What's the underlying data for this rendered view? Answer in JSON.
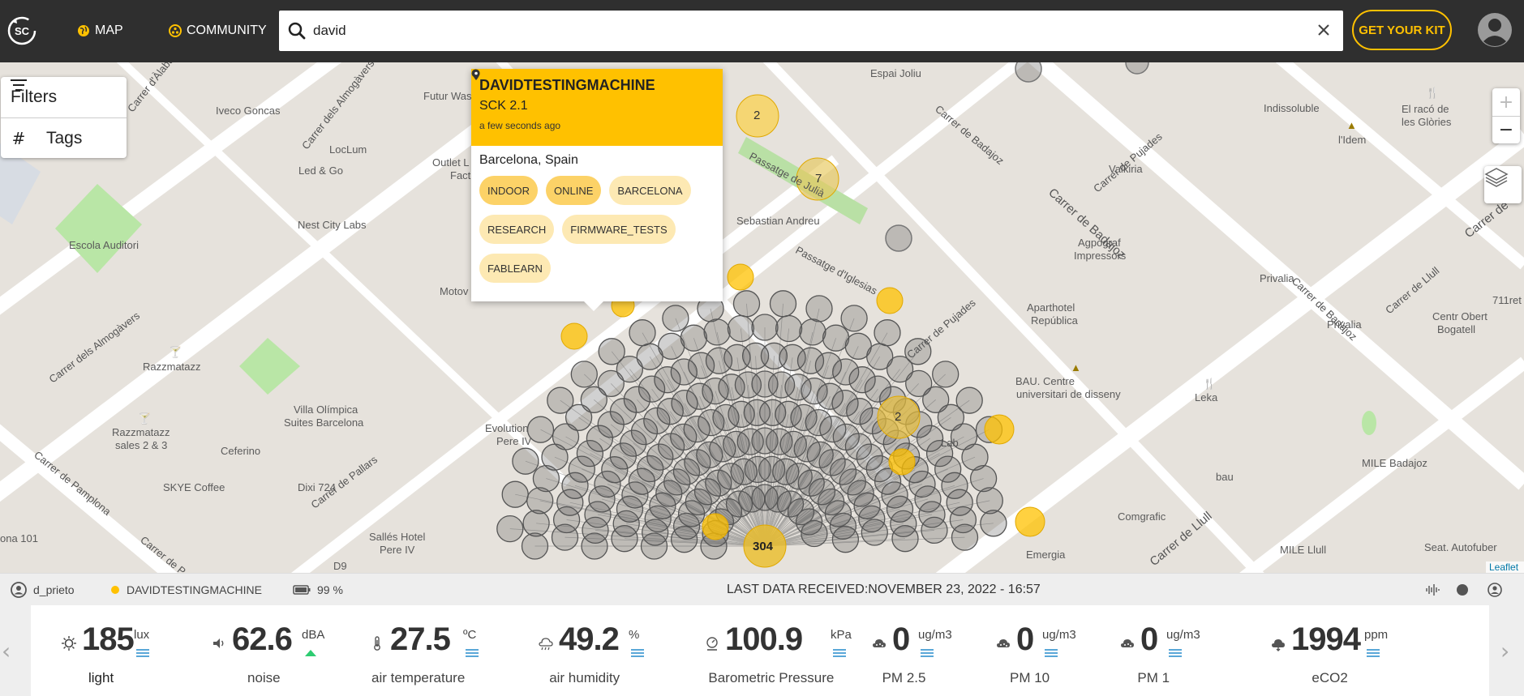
{
  "topbar": {
    "logo_text": "SC",
    "nav_map": "MAP",
    "nav_community": "COMMUNITY",
    "search_value": "david",
    "get_kit": "GET YOUR KIT",
    "accent_color": "#ffc100"
  },
  "map_panel": {
    "filters_label": "Filters",
    "tags_label": "Tags",
    "tags_icon": "#",
    "attribution": "Leaflet"
  },
  "map_labels": {
    "espai_joliu": "Espai Joliu",
    "iveco": "Iveco Goncas",
    "futur": "Futur Was",
    "outlet": "Outlet L",
    "fact": "Fact",
    "loclum": "LocLum",
    "ledgo": "Led & Go",
    "nestcity": "Nest City Labs",
    "escola": "Escola Auditori",
    "motov": "Motov",
    "razzmatazz": "Razzmatazz",
    "villa1": "Villa Olímpica",
    "villa2": "Suites Barcelona",
    "razz2a": "Razzmatazz",
    "razz2b": "sales 2 & 3",
    "ceferino": "Ceferino",
    "skye": "SKYE Coffee",
    "dixi": "Dixi 724",
    "salles1": "Sallés Hotel",
    "salles2": "Pere IV",
    "d9": "D9",
    "ona": "ona 101",
    "evolution1": "Evolution",
    "evolution2": "Pere IV",
    "sebastian": "Sebastian Andreu",
    "indissoluble": "Indissoluble",
    "elraco1": "El racó de",
    "elraco2": "les Glòries",
    "ldem": "l'Idem",
    "valkiria": "Valkiria",
    "agpograf1": "Agpograf",
    "agpograf2": "Impressors",
    "privalia1": "Privalia",
    "privalia2": "Privalia",
    "centr1": "Centr Obert",
    "centr2": "Bogatell",
    "aparthotel1": "Aparthotel",
    "aparthotel2": "República",
    "bau1": "BAU. Centre",
    "bau2": "universitari de disseny",
    "leka": "Leka",
    "bau_small": "bau",
    "mile_badajoz": "MILE Badajoz",
    "comgrafic": "Comgrafic",
    "emergia": "Emergia",
    "mile_llull": "MILE Llull",
    "seat": "Seat. Autofuber",
    "eleven": "711ret"
  },
  "streets": {
    "almogavers1": "Carrer dels Almogàvers",
    "almogavers2": "Carrer dels Almogàvers",
    "dalaba": "Carrer d'Àlaba",
    "pamplona": "Carrer de Pamplona",
    "pallars": "Carrer de Pallars",
    "badajoz1": "Carrer de Badajoz",
    "badajoz2": "Carrer de Badajoz",
    "badajoz3": "Carrer de Badajoz",
    "pujades1": "Carrer de Pujades",
    "pujades2": "Carrer de Pujades",
    "llull1": "Carrer de Llull",
    "llull2": "Carrer de Llull",
    "julias": "Passatge de Julià",
    "iglesias": "Passatge d'Iglesias",
    "carrerp": "Carrer de P",
    "carrerde": "Carrer de",
    "lab": "Lab"
  },
  "clusters": {
    "c1": "2",
    "c2": "7",
    "c3": "2",
    "c4": "304"
  },
  "popup": {
    "title": "DAVIDTESTINGMACHINE",
    "kit": "SCK 2.1",
    "time": "a few seconds ago",
    "location": "Barcelona, Spain",
    "tags": [
      "INDOOR",
      "ONLINE",
      "BARCELONA",
      "RESEARCH",
      "FIRMWARE_TESTS",
      "FABLEARN"
    ]
  },
  "statusbar": {
    "user": "d_prieto",
    "device": "DAVIDTESTINGMACHINE",
    "battery": "99 %",
    "last_data": "LAST DATA RECEIVED:NOVEMBER 23, 2022 - 16:57",
    "device_status_color": "#ffc100"
  },
  "sensors": [
    {
      "value": "185",
      "unit": "lux",
      "label": "light",
      "icon": "sun-icon"
    },
    {
      "value": "62.6",
      "unit": "dBA",
      "label": "noise",
      "icon": "speaker-icon"
    },
    {
      "value": "27.5",
      "unit": "ºC",
      "label": "air temperature",
      "icon": "thermometer-icon"
    },
    {
      "value": "49.2",
      "unit": "%",
      "label": "air humidity",
      "icon": "humidity-icon"
    },
    {
      "value": "100.9",
      "unit": "kPa",
      "label": "Barometric Pressure",
      "icon": "barometer-icon"
    },
    {
      "value": "0",
      "unit": "ug/m3",
      "label": "PM 2.5",
      "icon": "particles-icon"
    },
    {
      "value": "0",
      "unit": "ug/m3",
      "label": "PM 10",
      "icon": "particles-icon"
    },
    {
      "value": "0",
      "unit": "ug/m3",
      "label": "PM 1",
      "icon": "particles-icon"
    },
    {
      "value": "1994",
      "unit": "ppm",
      "label": "eCO2",
      "icon": "co2-icon"
    }
  ]
}
